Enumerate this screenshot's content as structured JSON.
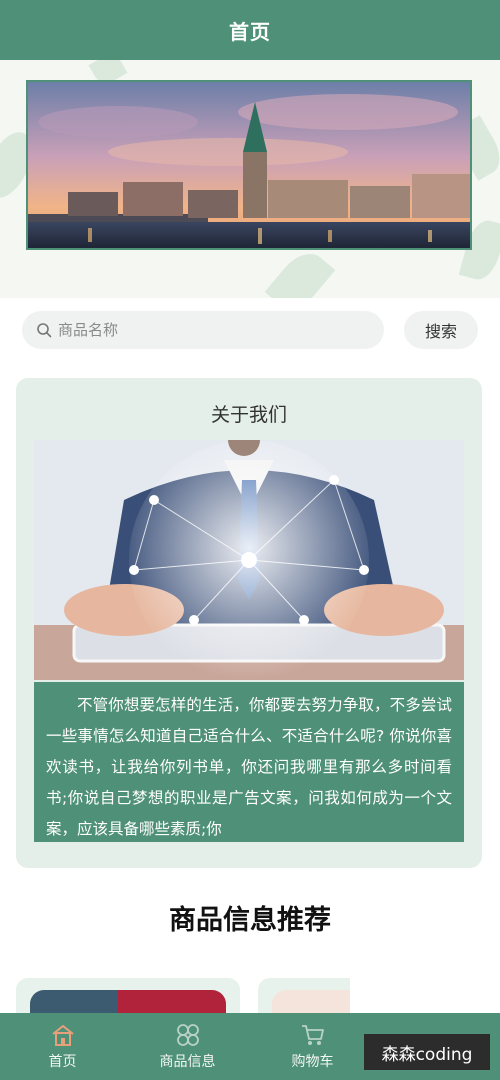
{
  "header": {
    "title": "首页"
  },
  "search": {
    "placeholder": "商品名称",
    "button_label": "搜索"
  },
  "about": {
    "title": "关于我们",
    "text": "不管你想要怎样的生活，你都要去努力争取，不多尝试一些事情怎么知道自己适合什么、不适合什么呢? 你说你喜欢读书，让我给你列书单，你还问我哪里有那么多时间看书;你说自己梦想的职业是广告文案，问我如何成为一个文案，应该具备哪些素质;你"
  },
  "recommend": {
    "title": "商品信息推荐"
  },
  "tabbar": {
    "items": [
      {
        "label": "首页",
        "icon": "home-icon"
      },
      {
        "label": "商品信息",
        "icon": "grid-icon"
      },
      {
        "label": "购物车",
        "icon": "cart-icon"
      },
      {
        "label": "",
        "icon": "user-icon"
      }
    ]
  },
  "watermark": {
    "text": "森森coding"
  },
  "colors": {
    "accent": "#4f9079",
    "card_bg": "#e3efe8",
    "search_bg": "#f0f2f1"
  }
}
